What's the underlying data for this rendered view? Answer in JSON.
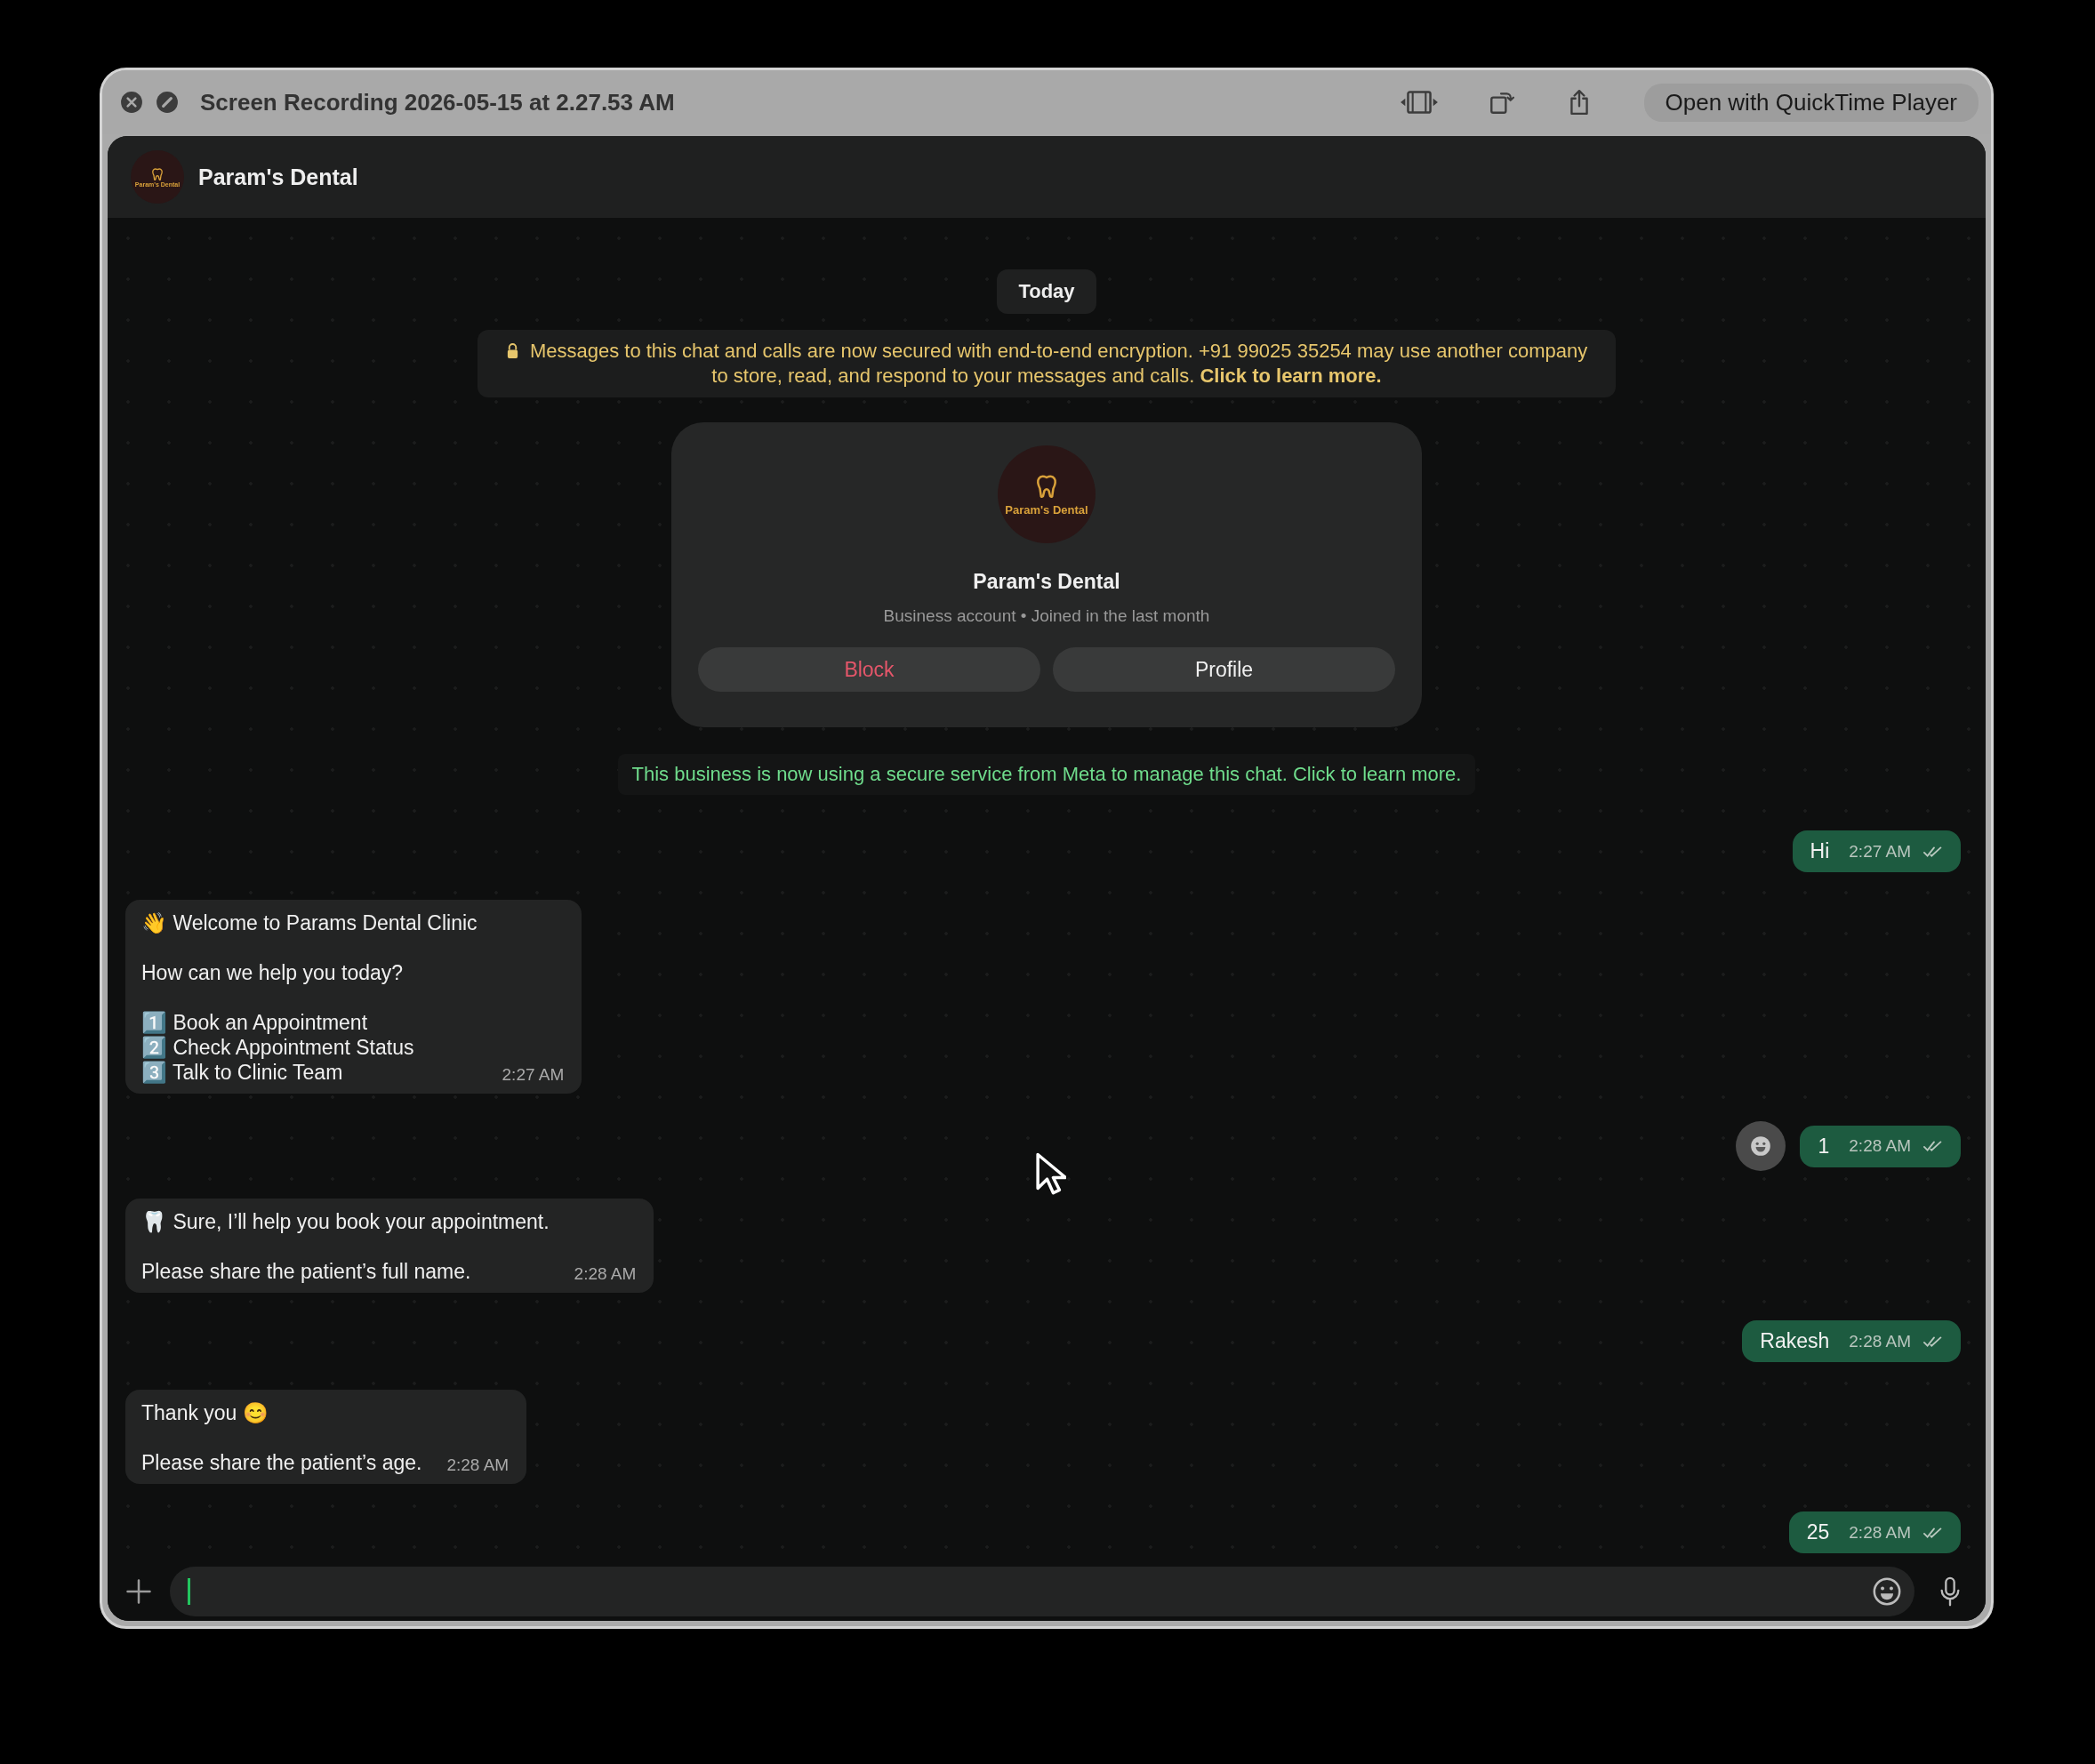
{
  "window": {
    "title": "Screen Recording 2026-05-15 at 2.27.53 AM",
    "open_button": "Open with QuickTime Player"
  },
  "chat_header": {
    "logo_text": "Param's Dental",
    "name": "Param's Dental"
  },
  "date_pill": "Today",
  "encryption_notice": "Messages to this chat and calls are now secured with end-to-end encryption. +91 99025 35254 may use another company to store, read, and respond to your messages and calls. **Click to learn more.**",
  "business_card": {
    "logo_text": "Param's Dental",
    "name": "Param's Dental",
    "subtitle": "Business account • Joined in the last month",
    "buttons": [
      {
        "label": "Block",
        "kind": "danger"
      },
      {
        "label": "Profile",
        "kind": "normal"
      }
    ]
  },
  "meta_notice": "This business is now using a secure service from Meta to manage this chat. Click to learn more.",
  "messages": [
    {
      "kind": "outgoing",
      "paragraphs": [
        "Hi"
      ],
      "time": "2:27 AM",
      "react_button": false
    },
    {
      "kind": "incoming",
      "paragraphs": [
        "👋 Welcome to Params Dental Clinic",
        "How can we help you today?",
        "1️⃣ Book an Appointment\n2️⃣ Check Appointment Status\n3️⃣ Talk to Clinic Team"
      ],
      "time": "2:27 AM"
    },
    {
      "kind": "outgoing",
      "paragraphs": [
        "1"
      ],
      "time": "2:28 AM",
      "react_button": true
    },
    {
      "kind": "incoming",
      "paragraphs": [
        "🦷 Sure, I’ll help you book your appointment.",
        "Please share the patient’s full name."
      ],
      "time": "2:28 AM"
    },
    {
      "kind": "outgoing",
      "paragraphs": [
        "Rakesh"
      ],
      "time": "2:28 AM",
      "react_button": false
    },
    {
      "kind": "incoming",
      "paragraphs": [
        "Thank you 😊",
        "Please share the patient’s age."
      ],
      "time": "2:28 AM"
    },
    {
      "kind": "outgoing",
      "paragraphs": [
        "25"
      ],
      "time": "2:28 AM",
      "react_button": false
    }
  ],
  "composer": {
    "focused": true
  }
}
